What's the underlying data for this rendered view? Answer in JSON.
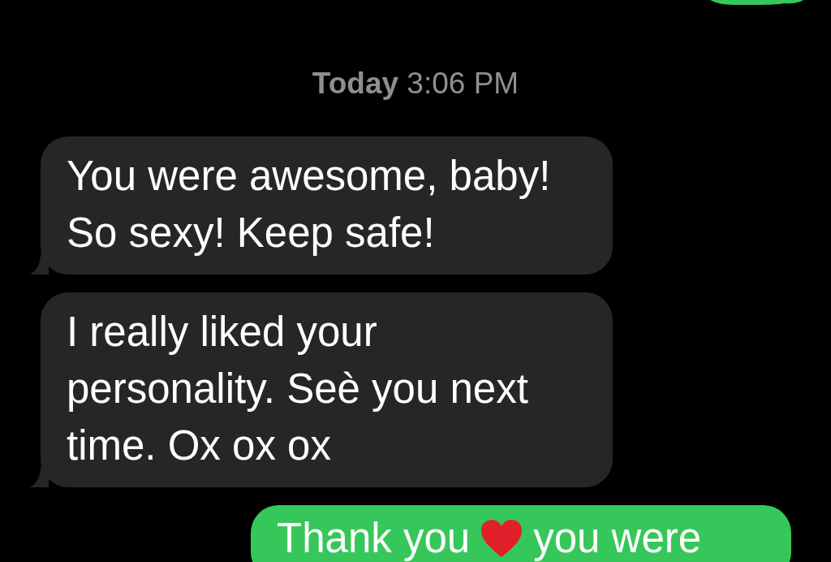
{
  "timestamp": "**Today** 3:06 PM",
  "messages": [
    {
      "kind": "received",
      "text": "You were awesome, baby! So sexy! Keep safe!"
    },
    {
      "kind": "received",
      "text": "I really liked your personality. Seè you next time. Ox ox ox"
    },
    {
      "kind": "sent",
      "text": "Thank you",
      "text_after": "you were"
    }
  ]
}
